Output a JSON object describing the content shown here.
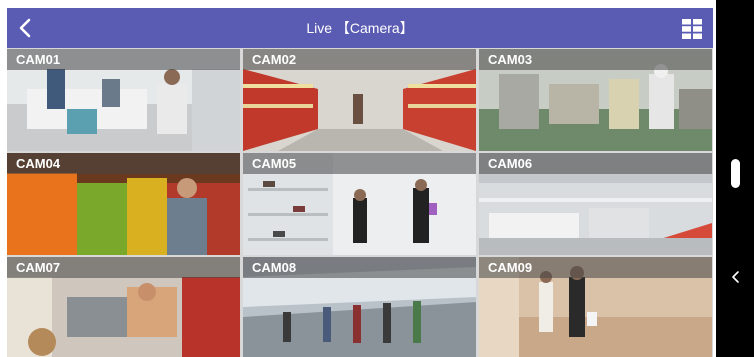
{
  "app": {
    "title": "Live  【Camera】",
    "back_icon": "chevron-left-icon",
    "layout_icon": "grid-layout-icon",
    "bar_color": "#5a5bb3"
  },
  "cameras": [
    {
      "label": "CAM01",
      "scene": "checkout counter"
    },
    {
      "label": "CAM02",
      "scene": "supermarket aisle"
    },
    {
      "label": "CAM03",
      "scene": "factory floor"
    },
    {
      "label": "CAM04",
      "scene": "produce section"
    },
    {
      "label": "CAM05",
      "scene": "shoe display"
    },
    {
      "label": "CAM06",
      "scene": "production line"
    },
    {
      "label": "CAM07",
      "scene": "cash register"
    },
    {
      "label": "CAM08",
      "scene": "escalator"
    },
    {
      "label": "CAM09",
      "scene": "shopping mall"
    }
  ],
  "side_panel": {
    "handle_icon": "scroll-handle",
    "collapse_icon": "chevron-left-icon"
  }
}
